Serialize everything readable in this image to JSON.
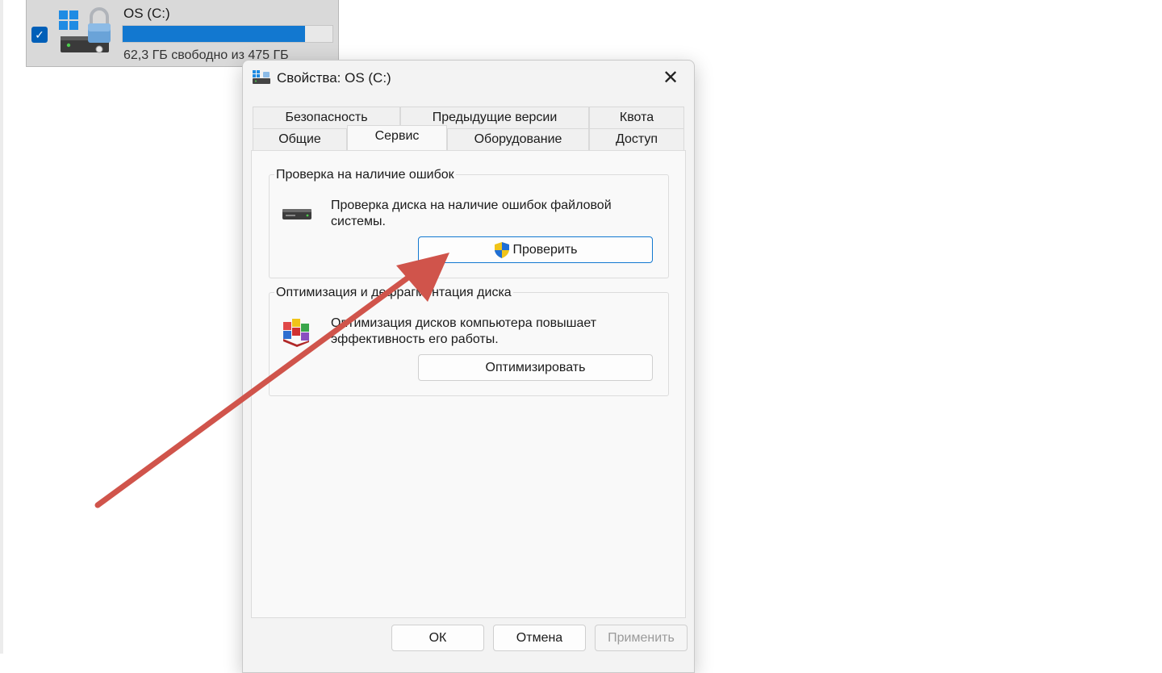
{
  "explorer": {
    "drive_name": "OS (C:)",
    "free_space_text": "62,3 ГБ свободно из 475 ГБ",
    "usage_fraction": 0.87,
    "selected": true,
    "check_glyph": "✓"
  },
  "dialog": {
    "title": "Свойства: OS (C:)",
    "close_glyph": "✕",
    "tabs_row1": [
      "Безопасность",
      "Предыдущие версии",
      "Квота"
    ],
    "tabs_row2": [
      "Общие",
      "Сервис",
      "Оборудование",
      "Доступ"
    ],
    "active_tab": "Сервис",
    "error_check": {
      "title": "Проверка на наличие ошибок",
      "description_line1": "Проверка диска на наличие ошибок файловой",
      "description_line2": "системы.",
      "button_label": "Проверить",
      "icon": "hard-drive-icon"
    },
    "optimize": {
      "title": "Оптимизация и дефрагментация диска",
      "description_line1": "Оптимизация дисков компьютера повышает",
      "description_line2": "эффективность его работы.",
      "button_label": "Оптимизировать",
      "icon": "defrag-icon"
    },
    "footer": {
      "ok_label": "ОК",
      "cancel_label": "Отмена",
      "apply_label": "Применить"
    }
  },
  "colors": {
    "accent": "#1278d0",
    "annotation_arrow": "#d0544b"
  }
}
